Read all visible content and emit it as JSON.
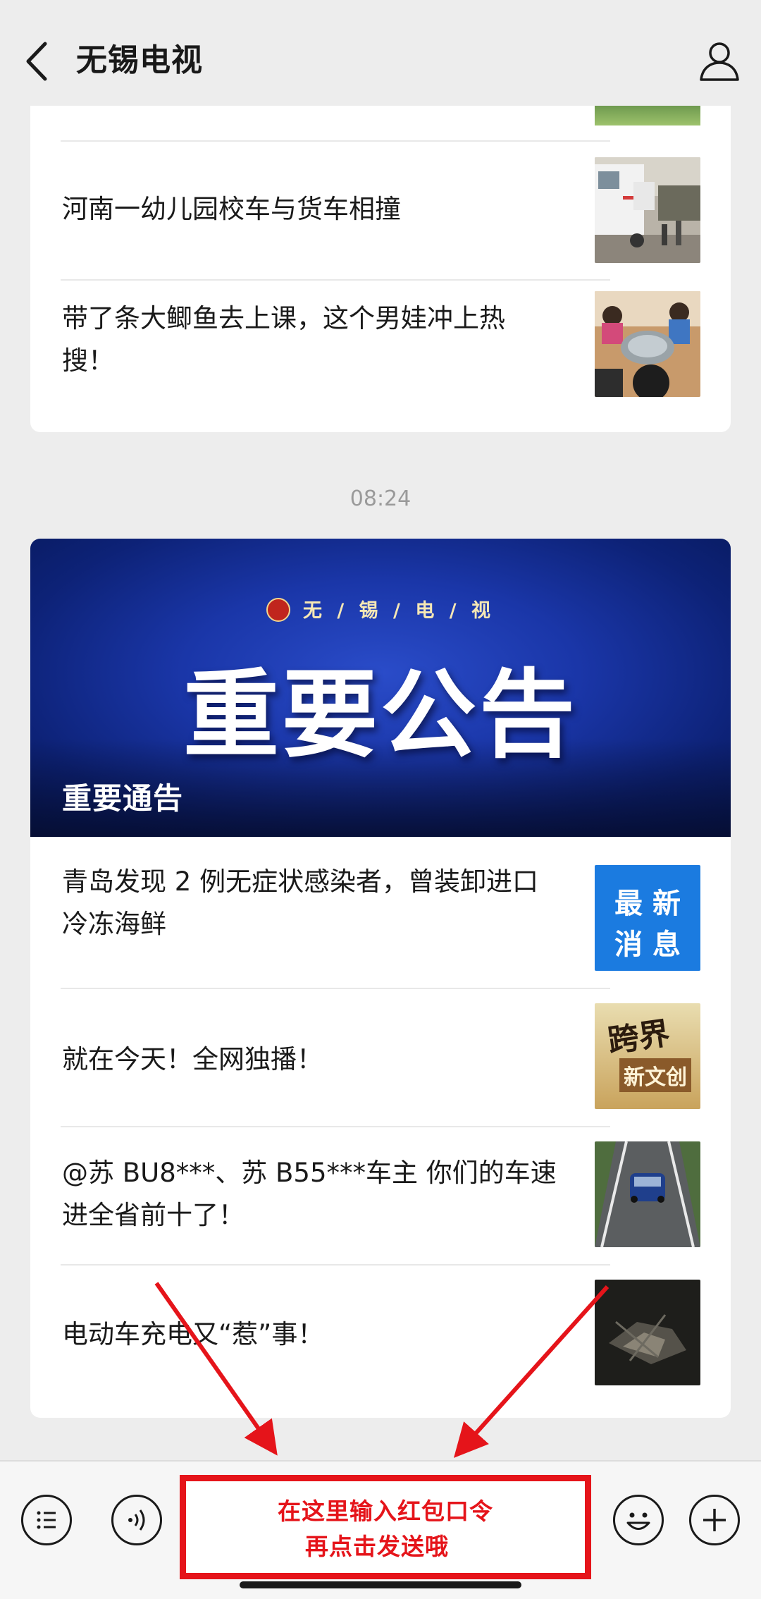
{
  "header": {
    "title": "无锡电视"
  },
  "card1": {
    "items": [
      {
        "title": "河南一幼儿园校车与货车相撞",
        "thumb": "ambulance-accident-photo"
      },
      {
        "title_line1": "带了条大鲫鱼去上课，这个男娃冲上热",
        "title_line2": "搜！",
        "thumb": "children-fish-photo"
      }
    ]
  },
  "timestamp": "08:24",
  "card2": {
    "banner": {
      "brand": "无 / 锡 / 电 / 视",
      "headline": "重要公告",
      "caption": "重要通告"
    },
    "items": [
      {
        "title_line1": "青岛发现 2 例无症状感染者，曾装卸进口",
        "title_line2": "冷冻海鲜",
        "thumb_line1": "最 新",
        "thumb_line2": "消 息"
      },
      {
        "title": "就在今天！全网独播！",
        "thumb_text1": "跨界",
        "thumb_text2": "新文创"
      },
      {
        "title_line1": "@苏 BU8***、苏 B55***车主 你们的车速",
        "title_line2": "进全省前十了！",
        "thumb": "car-on-road-photo"
      },
      {
        "title": "电动车充电又“惹”事！",
        "thumb": "burnt-scooter-photo"
      }
    ]
  },
  "bottombar": {
    "input_line1": "在这里输入红包口令",
    "input_line2": "再点击发送哦"
  },
  "colors": {
    "accent_red": "#e5141a",
    "banner_blue": "#1a36a8",
    "page_bg": "#ededed"
  }
}
